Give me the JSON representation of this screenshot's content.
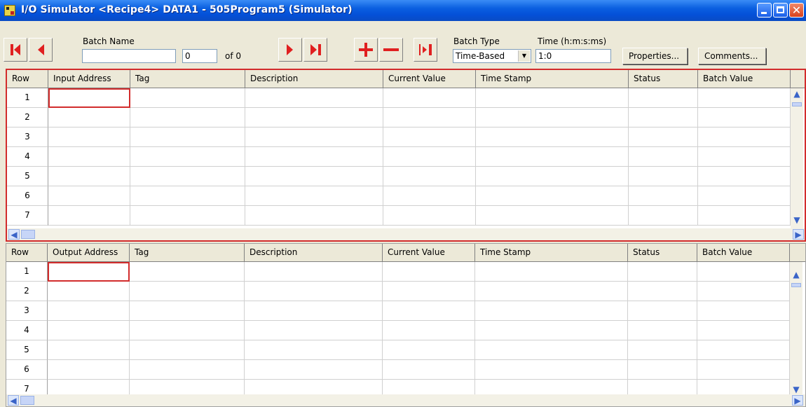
{
  "window": {
    "title": "I/O Simulator <Recipe4> DATA1 - 505Program5 (Simulator)",
    "min_glyph": "",
    "max_glyph": "",
    "close_glyph": "✕"
  },
  "toolbar": {
    "batch_name_label": "Batch Name",
    "batch_name_value": "",
    "batch_index_value": "0",
    "batch_of_text": "of  0",
    "batch_type_label": "Batch Type",
    "batch_type_value": "Time-Based",
    "time_label": "Time (h:m:s:ms)",
    "time_value": "1:0",
    "properties_label": "Properties...",
    "comments_label": "Comments..."
  },
  "colors": {
    "accent_red": "#d22c2c",
    "titlebar_blue": "#0a5fe0"
  },
  "input_grid": {
    "columns": [
      "Row",
      "Input Address",
      "Tag",
      "Description",
      "Current Value",
      "Time Stamp",
      "Status",
      "Batch Value"
    ],
    "rows": [
      "1",
      "2",
      "3",
      "4",
      "5",
      "6",
      "7"
    ]
  },
  "output_grid": {
    "columns": [
      "Row",
      "Output Address",
      "Tag",
      "Description",
      "Current Value",
      "Time Stamp",
      "Status",
      "Batch Value"
    ],
    "rows": [
      "1",
      "2",
      "3",
      "4",
      "5",
      "6",
      "7"
    ]
  }
}
